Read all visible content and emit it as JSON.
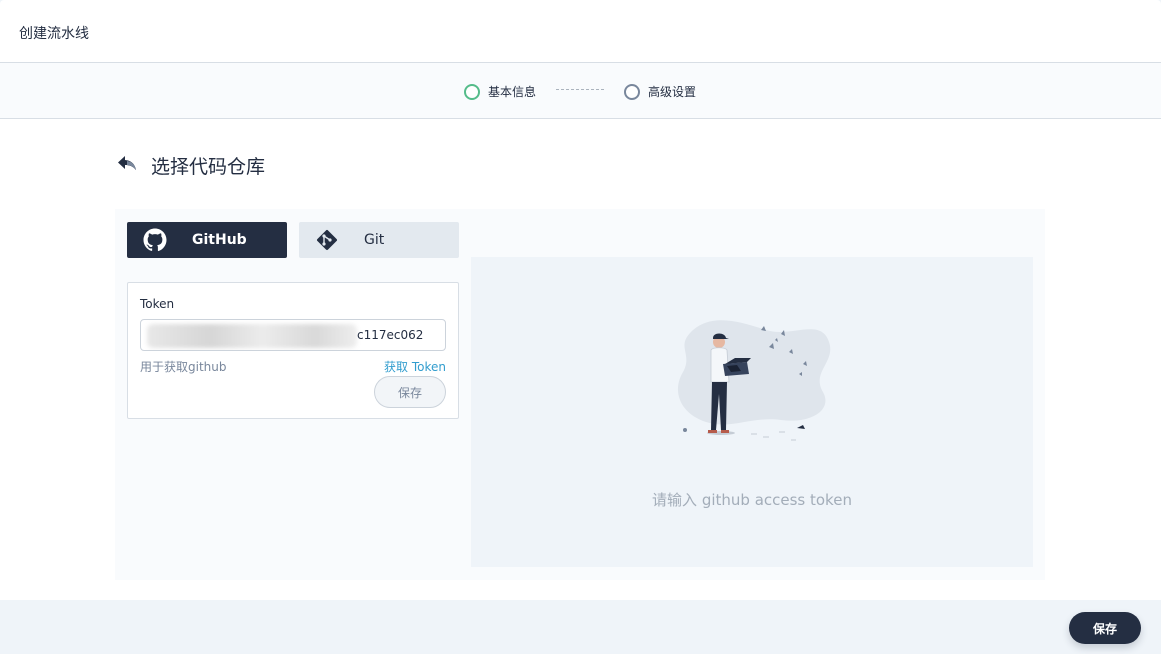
{
  "header": {
    "title": "创建流水线"
  },
  "steps": [
    {
      "label": "基本信息",
      "state": "active"
    },
    {
      "label": "高级设置",
      "state": "pending"
    }
  ],
  "page": {
    "title": "选择代码仓库"
  },
  "tabs": [
    {
      "label": "GitHub",
      "icon": "github-icon",
      "selected": true
    },
    {
      "label": "Git",
      "icon": "git-icon",
      "selected": false
    }
  ],
  "token": {
    "label": "Token",
    "value_visible": "c117ec062",
    "description": "用于获取github",
    "link_label": "获取 Token",
    "save_label": "保存"
  },
  "empty": {
    "message": "请输入 github access token"
  },
  "footer": {
    "save_label": "保存"
  },
  "colors": {
    "primary_dark": "#242e42",
    "success": "#55bc8a",
    "link": "#329dce",
    "muted": "#79879c"
  }
}
